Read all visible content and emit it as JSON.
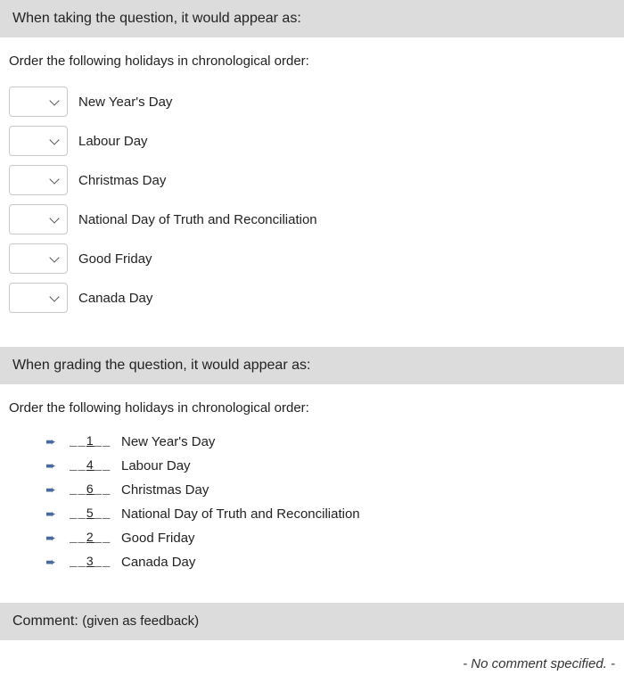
{
  "sections": {
    "taking_header": "When taking the question, it would appear as:",
    "grading_header": "When grading the question, it would appear as:",
    "comment_header_prefix": "Comment:",
    "comment_header_note": "(given as feedback)"
  },
  "prompt": "Order the following holidays in chronological order:",
  "items": [
    {
      "label": "New Year's Day",
      "correct_order": "1"
    },
    {
      "label": "Labour Day",
      "correct_order": "4"
    },
    {
      "label": "Christmas Day",
      "correct_order": "6"
    },
    {
      "label": "National Day of Truth and Reconciliation",
      "correct_order": "5"
    },
    {
      "label": "Good Friday",
      "correct_order": "2"
    },
    {
      "label": "Canada Day",
      "correct_order": "3"
    }
  ],
  "comment_text": "- No comment specified. -"
}
